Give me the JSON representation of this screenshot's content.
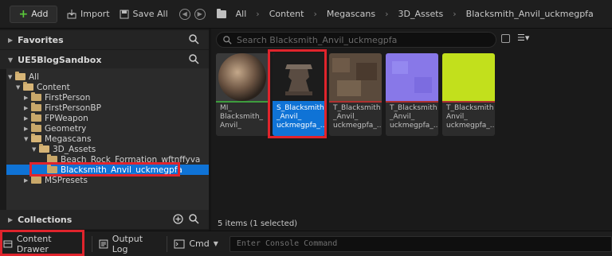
{
  "toolbar": {
    "add_label": "Add",
    "import_label": "Import",
    "save_all_label": "Save All",
    "breadcrumbs": [
      "All",
      "Content",
      "Megascans",
      "3D_Assets",
      "Blacksmith_Anvil_uckmegpfa"
    ]
  },
  "left": {
    "favorites_label": "Favorites",
    "project_label": "UE5BlogSandbox",
    "collections_label": "Collections",
    "tree": [
      {
        "label": "All"
      },
      {
        "label": "Content"
      },
      {
        "label": "FirstPerson"
      },
      {
        "label": "FirstPersonBP"
      },
      {
        "label": "FPWeapon"
      },
      {
        "label": "Geometry"
      },
      {
        "label": "Megascans"
      },
      {
        "label": "3D_Assets"
      },
      {
        "label": "Beach_Rock_Formation_wftnffyva"
      },
      {
        "label": "Blacksmith_Anvil_uckmegpfa"
      },
      {
        "label": "MSPresets"
      }
    ]
  },
  "right": {
    "search_placeholder": "Search Blacksmith_Anvil_uckmegpfa",
    "assets": [
      {
        "label": "MI_\nBlacksmith_\nAnvil_",
        "bar_color": "#3d9c3d"
      },
      {
        "label": "S_Blacksmith\n_Anvil_\nuckmegpfa_...",
        "bar_color": "#0f73d6"
      },
      {
        "label": "T_Blacksmith\n_Anvil_\nuckmegpfa_...",
        "bar_color": "#b03030"
      },
      {
        "label": "T_Blacksmith\n_Anvil_\nuckmegpfa_...",
        "bar_color": "#b03030"
      },
      {
        "label": "T_Blacksmith\nAnvil_\nuckmegpfa_...",
        "bar_color": "#b03030"
      }
    ],
    "status": "5 items (1 selected)"
  },
  "bottom": {
    "content_drawer_label": "Content Drawer",
    "output_log_label": "Output Log",
    "cmd_label": "Cmd",
    "console_placeholder": "Enter Console Command"
  },
  "colors": {
    "accent": "#0f73d6",
    "highlight": "#e0242c"
  }
}
